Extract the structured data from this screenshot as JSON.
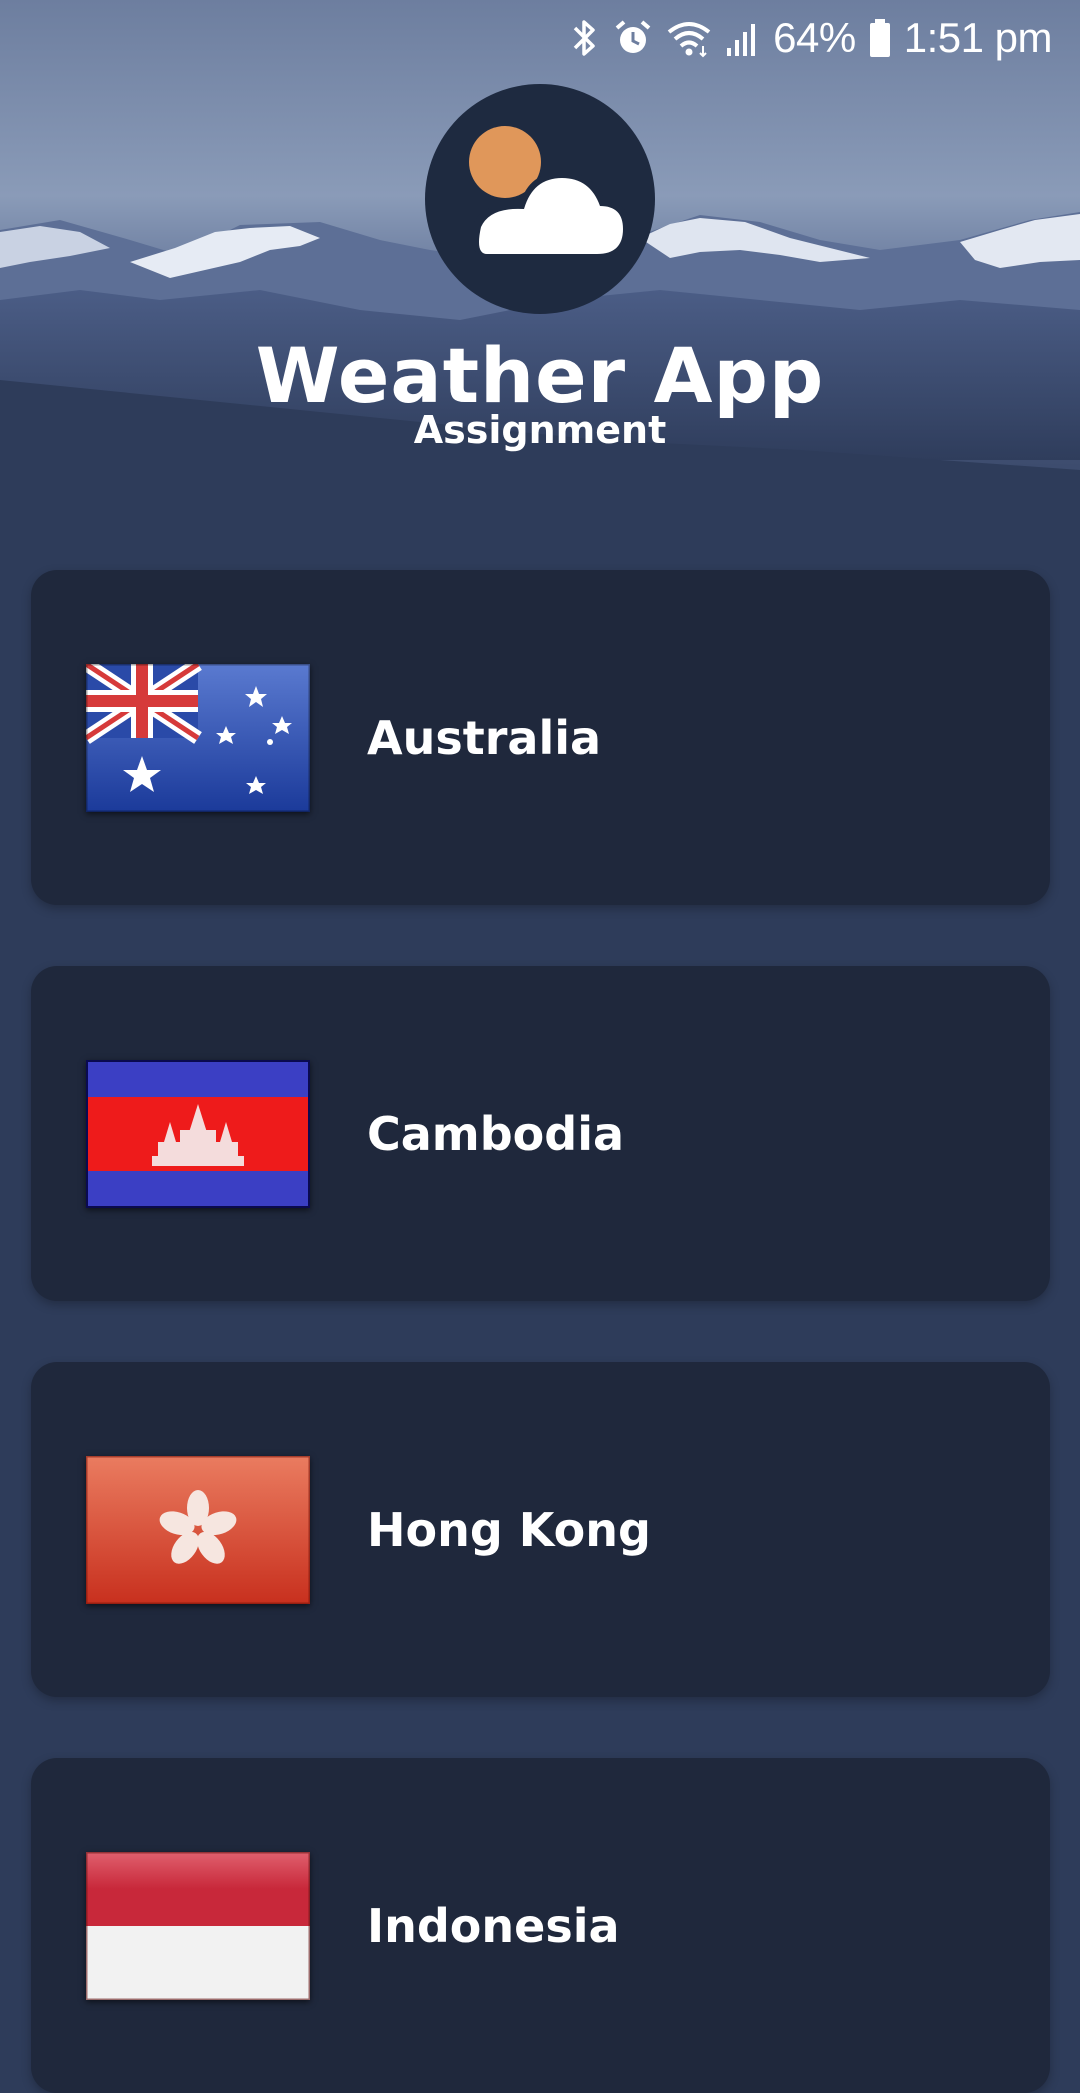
{
  "status_bar": {
    "battery": "64%",
    "time": "1:51 pm",
    "icons": [
      "bluetooth-icon",
      "alarm-icon",
      "wifi-icon",
      "signal-icon",
      "battery-icon"
    ]
  },
  "header": {
    "logo_icon": "sun-cloud-icon",
    "title": "Weather App",
    "subtitle": "Assignment"
  },
  "countries": [
    {
      "name": "Australia",
      "flag_icon": "australia-flag-icon"
    },
    {
      "name": "Cambodia",
      "flag_icon": "cambodia-flag-icon"
    },
    {
      "name": "Hong Kong",
      "flag_icon": "hong-kong-flag-icon"
    },
    {
      "name": "Indonesia",
      "flag_icon": "indonesia-flag-icon"
    }
  ],
  "colors": {
    "background": "#2e3c5a",
    "card": "#1f283c",
    "logo_bg": "#1e2a40",
    "sun": "#e0975a",
    "text": "#ffffff"
  }
}
